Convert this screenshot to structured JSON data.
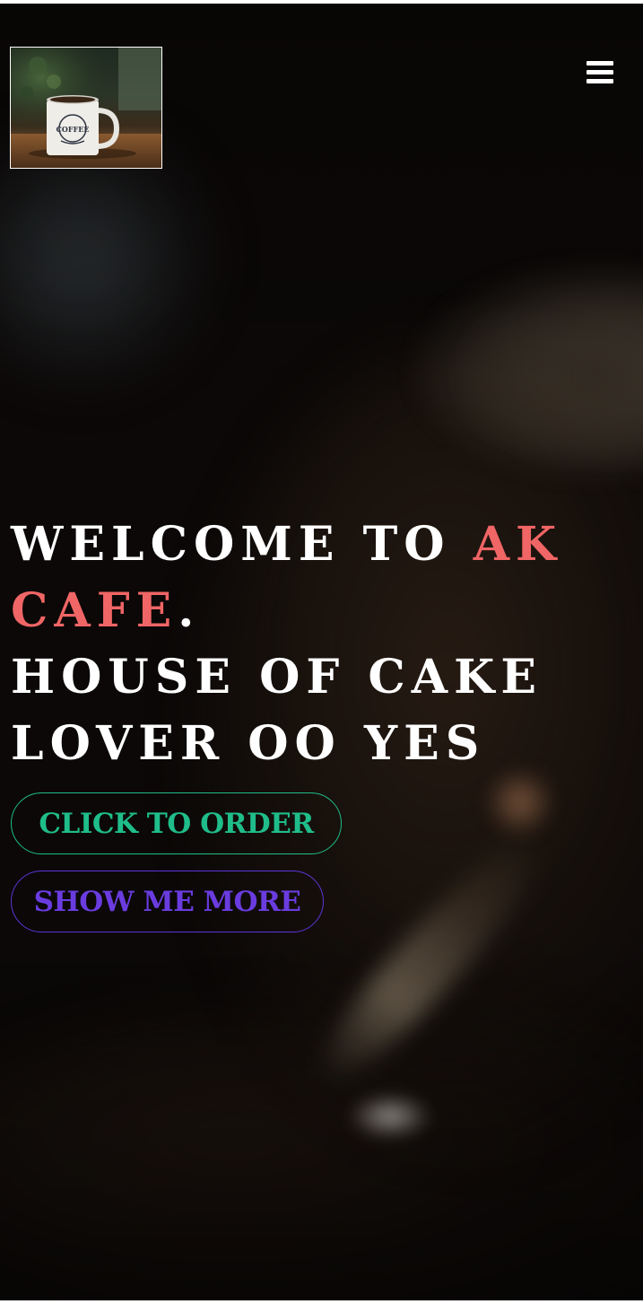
{
  "header": {
    "logo_icon": "coffee-mug-icon",
    "logo_mug_text": "COFFEE",
    "menu_icon": "hamburger-menu-icon"
  },
  "hero": {
    "line1_prefix": "WELCOME TO ",
    "line1_brand": "AK",
    "line2_brand": "CAFE",
    "line2_suffix": ".",
    "line3": "HOUSE OF CAKE",
    "line4": "LOVER OO YES"
  },
  "buttons": {
    "order_label": "CLICK TO ORDER",
    "more_label": "SHOW ME MORE"
  },
  "colors": {
    "accent": "#f06565",
    "order_button": "#1fbd8a",
    "more_button": "#6a3ce0",
    "background": "#0b0807"
  }
}
